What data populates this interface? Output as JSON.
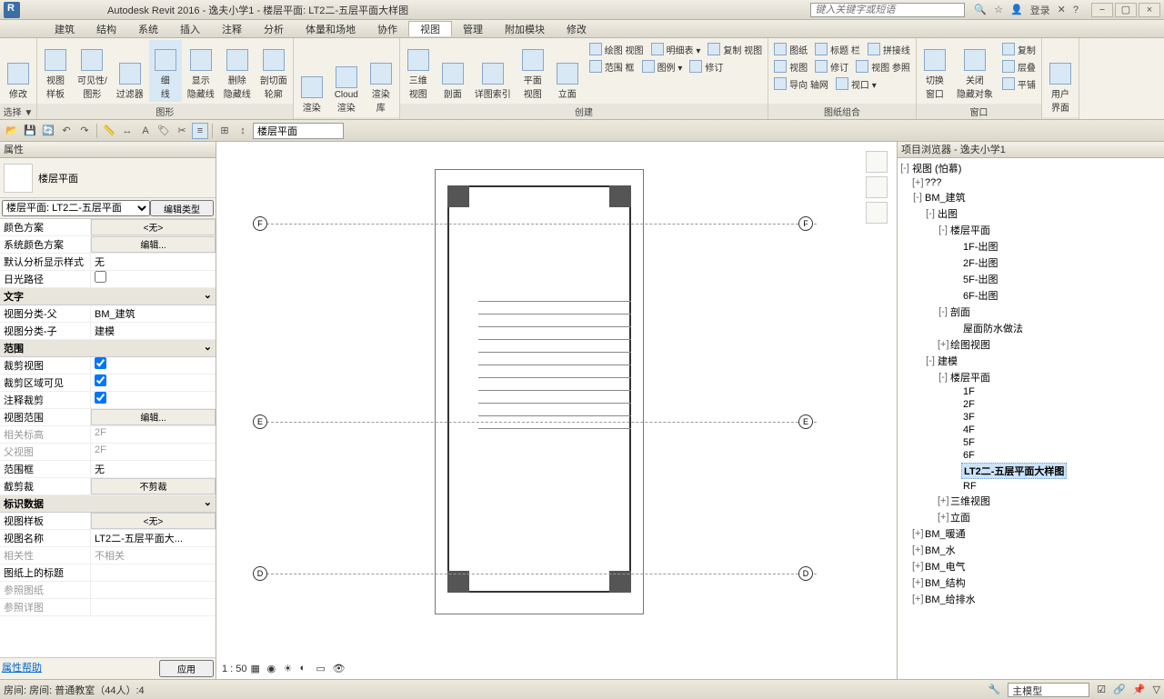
{
  "title": "Autodesk Revit 2016 -     逸夫小学1 - 楼层平面: LT2二-五层平面大样图",
  "search_placeholder": "键入关键字或短语",
  "login": "登录",
  "menu": [
    "建筑",
    "结构",
    "系统",
    "插入",
    "注释",
    "分析",
    "体量和场地",
    "协作",
    "视图",
    "管理",
    "附加模块",
    "修改"
  ],
  "menu_active": 8,
  "ribbon": {
    "panels": [
      {
        "label": "选择 ▼",
        "btns": [
          {
            "t": "修改"
          }
        ]
      },
      {
        "label": "图形",
        "btns": [
          {
            "t": "视图\n样板"
          },
          {
            "t": "可见性/\n图形"
          },
          {
            "t": "过滤器"
          },
          {
            "t": "细\n线",
            "active": true
          },
          {
            "t": "显示\n隐藏线"
          },
          {
            "t": "删除\n隐藏线"
          },
          {
            "t": "剖切面\n轮廓"
          }
        ]
      },
      {
        "label": "",
        "btns": [
          {
            "t": "渲染"
          },
          {
            "t": "Cloud\n渲染"
          },
          {
            "t": "渲染\n库"
          }
        ]
      },
      {
        "label": "创建",
        "btns": [
          {
            "t": "三维\n视图"
          },
          {
            "t": "剖面"
          },
          {
            "t": "详图索引"
          },
          {
            "t": "平面\n视图"
          },
          {
            "t": "立面"
          }
        ],
        "small": [
          [
            "绘图 视图",
            "明细表 ▾",
            "复制 视图"
          ],
          [
            "范围 框",
            "图例 ▾",
            "修订"
          ]
        ]
      },
      {
        "label": "图纸组合",
        "small": [
          [
            "图纸",
            "标题 栏",
            "拼接线"
          ],
          [
            "视图",
            "修订",
            "视图 参照"
          ],
          [
            "导向 轴网",
            "视口 ▾",
            ""
          ]
        ]
      },
      {
        "label": "窗口",
        "btns": [
          {
            "t": "切换\n窗口"
          },
          {
            "t": "关闭\n隐藏对象"
          }
        ],
        "small": [
          [
            "复制"
          ],
          [
            "层叠"
          ],
          [
            "平铺"
          ]
        ]
      },
      {
        "label": "",
        "btns": [
          {
            "t": "用户\n界面"
          }
        ]
      }
    ]
  },
  "qat_combo": "楼层平面",
  "properties": {
    "title": "属性",
    "type_name": "楼层平面",
    "selector": "楼层平面: LT2二-五层平面",
    "edit_type": "编辑类型",
    "cats": [
      {
        "name": "",
        "rows": [
          {
            "k": "颜色方案",
            "btn": "<无>"
          },
          {
            "k": "系统颜色方案",
            "btn": "编辑..."
          },
          {
            "k": "默认分析显示样式",
            "v": "无"
          },
          {
            "k": "日光路径",
            "chk": false
          }
        ]
      },
      {
        "name": "文字",
        "rows": [
          {
            "k": "视图分类-父",
            "v": "BM_建筑"
          },
          {
            "k": "视图分类-子",
            "v": "建模"
          }
        ]
      },
      {
        "name": "范围",
        "rows": [
          {
            "k": "裁剪视图",
            "chk": true
          },
          {
            "k": "裁剪区域可见",
            "chk": true
          },
          {
            "k": "注释裁剪",
            "chk": true
          },
          {
            "k": "视图范围",
            "btn": "编辑..."
          },
          {
            "k": "相关标高",
            "v": "2F",
            "dim": true
          },
          {
            "k": "父视图",
            "v": "2F",
            "dim": true
          },
          {
            "k": "范围框",
            "v": "无"
          },
          {
            "k": "截剪裁",
            "btn": "不剪裁"
          }
        ]
      },
      {
        "name": "标识数据",
        "rows": [
          {
            "k": "视图样板",
            "btn": "<无>"
          },
          {
            "k": "视图名称",
            "v": "LT2二-五层平面大..."
          },
          {
            "k": "相关性",
            "v": "不相关",
            "dim": true
          },
          {
            "k": "图纸上的标题",
            "v": ""
          },
          {
            "k": "参照图纸",
            "v": "",
            "dim": true
          },
          {
            "k": "参照详图",
            "v": "",
            "dim": true
          }
        ]
      }
    ],
    "help": "属性帮助",
    "apply": "应用"
  },
  "scale_label": "1 : 50",
  "browser": {
    "title": "项目浏览器 - 逸夫小学1",
    "tree": [
      {
        "l": "视图 (怕慕)",
        "d": 0,
        "e": "-"
      },
      {
        "l": "???",
        "d": 1,
        "e": "+"
      },
      {
        "l": "BM_建筑",
        "d": 1,
        "e": "-"
      },
      {
        "l": "出图",
        "d": 2,
        "e": "-"
      },
      {
        "l": "楼层平面",
        "d": 3,
        "e": "-"
      },
      {
        "l": "1F-出图",
        "d": 4
      },
      {
        "l": "2F-出图",
        "d": 4
      },
      {
        "l": "5F-出图",
        "d": 4
      },
      {
        "l": "6F-出图",
        "d": 4
      },
      {
        "l": "剖面",
        "d": 3,
        "e": "-"
      },
      {
        "l": "屋面防水做法",
        "d": 4
      },
      {
        "l": "绘图视图",
        "d": 3,
        "e": "+"
      },
      {
        "l": "建模",
        "d": 2,
        "e": "-"
      },
      {
        "l": "楼层平面",
        "d": 3,
        "e": "-"
      },
      {
        "l": "1F",
        "d": 4
      },
      {
        "l": "2F",
        "d": 4
      },
      {
        "l": "3F",
        "d": 4
      },
      {
        "l": "4F",
        "d": 4
      },
      {
        "l": "5F",
        "d": 4
      },
      {
        "l": "6F",
        "d": 4
      },
      {
        "l": "LT2二-五层平面大样图",
        "d": 4,
        "sel": true,
        "bold": true
      },
      {
        "l": "RF",
        "d": 4
      },
      {
        "l": "三维视图",
        "d": 3,
        "e": "+"
      },
      {
        "l": "立面",
        "d": 3,
        "e": "+"
      },
      {
        "l": "BM_暖通",
        "d": 1,
        "e": "+"
      },
      {
        "l": "BM_水",
        "d": 1,
        "e": "+"
      },
      {
        "l": "BM_电气",
        "d": 1,
        "e": "+"
      },
      {
        "l": "BM_结构",
        "d": 1,
        "e": "+"
      },
      {
        "l": "BM_给排水",
        "d": 1,
        "e": "+"
      }
    ]
  },
  "status": {
    "left": "房间: 房间: 普通教室（44人）:4",
    "combo": "主模型"
  },
  "grid_labels": {
    "top": "F",
    "mid": "E",
    "bot": "D"
  }
}
